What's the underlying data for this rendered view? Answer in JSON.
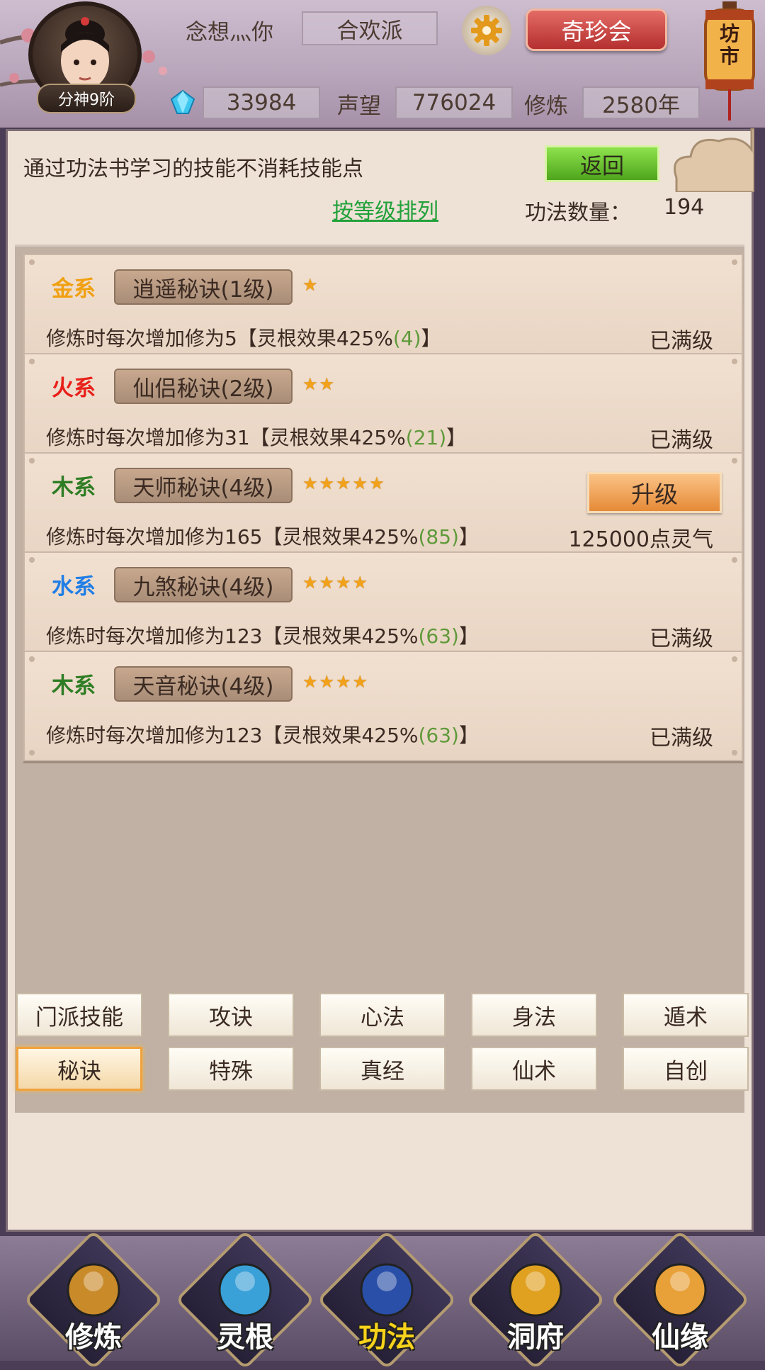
{
  "header": {
    "rank_badge": "分神9阶",
    "player_name": "念想灬你",
    "sect": "合欢派",
    "treasure_button": "奇珍会",
    "market_label": "坊市",
    "spirit_stones": "33984",
    "reputation_label": "声望",
    "reputation": "776024",
    "cultivation_label": "修炼",
    "cultivation_years": "2580年"
  },
  "panel": {
    "notice": "通过功法书学习的技能不消耗技能点",
    "back_button": "返回",
    "sort_link": "按等级排列",
    "count_label": "功法数量：",
    "count_value": "194"
  },
  "skills": [
    {
      "element": "金系",
      "element_color": "#f0a010",
      "name": "逍遥秘诀(1级)",
      "stars": 1,
      "desc_pre": "修炼时每次增加修为5【灵根效果425%",
      "desc_num": "(4)",
      "desc_post": "】",
      "status": "已满级"
    },
    {
      "element": "火系",
      "element_color": "#e8201a",
      "name": "仙侣秘诀(2级)",
      "stars": 2,
      "desc_pre": "修炼时每次增加修为31【灵根效果425%",
      "desc_num": "(21)",
      "desc_post": "】",
      "status": "已满级"
    },
    {
      "element": "木系",
      "element_color": "#2e7d24",
      "name": "天师秘诀(4级)",
      "stars": 5,
      "desc_pre": "修炼时每次增加修为165【灵根效果425%",
      "desc_num": "(85)",
      "desc_post": "】",
      "status": "125000点灵气",
      "upgrade": "升级"
    },
    {
      "element": "水系",
      "element_color": "#1f7ee6",
      "name": "九煞秘诀(4级)",
      "stars": 4,
      "desc_pre": "修炼时每次增加修为123【灵根效果425%",
      "desc_num": "(63)",
      "desc_post": "】",
      "status": "已满级"
    },
    {
      "element": "木系",
      "element_color": "#2e7d24",
      "name": "天音秘诀(4级)",
      "stars": 4,
      "desc_pre": "修炼时每次增加修为123【灵根效果425%",
      "desc_num": "(63)",
      "desc_post": "】",
      "status": "已满级"
    }
  ],
  "tabs_row1": [
    "门派技能",
    "攻诀",
    "心法",
    "身法",
    "遁术"
  ],
  "tabs_row2": [
    "秘诀",
    "特殊",
    "真经",
    "仙术",
    "自创"
  ],
  "active_tab": "秘诀",
  "bottom_nav": [
    {
      "label": "修炼",
      "icon": "meditation-icon"
    },
    {
      "label": "灵根",
      "icon": "yin-yang-sword-icon"
    },
    {
      "label": "功法",
      "icon": "book-icon",
      "active": true
    },
    {
      "label": "洞府",
      "icon": "pagoda-icon"
    },
    {
      "label": "仙缘",
      "icon": "gourd-icon"
    }
  ]
}
